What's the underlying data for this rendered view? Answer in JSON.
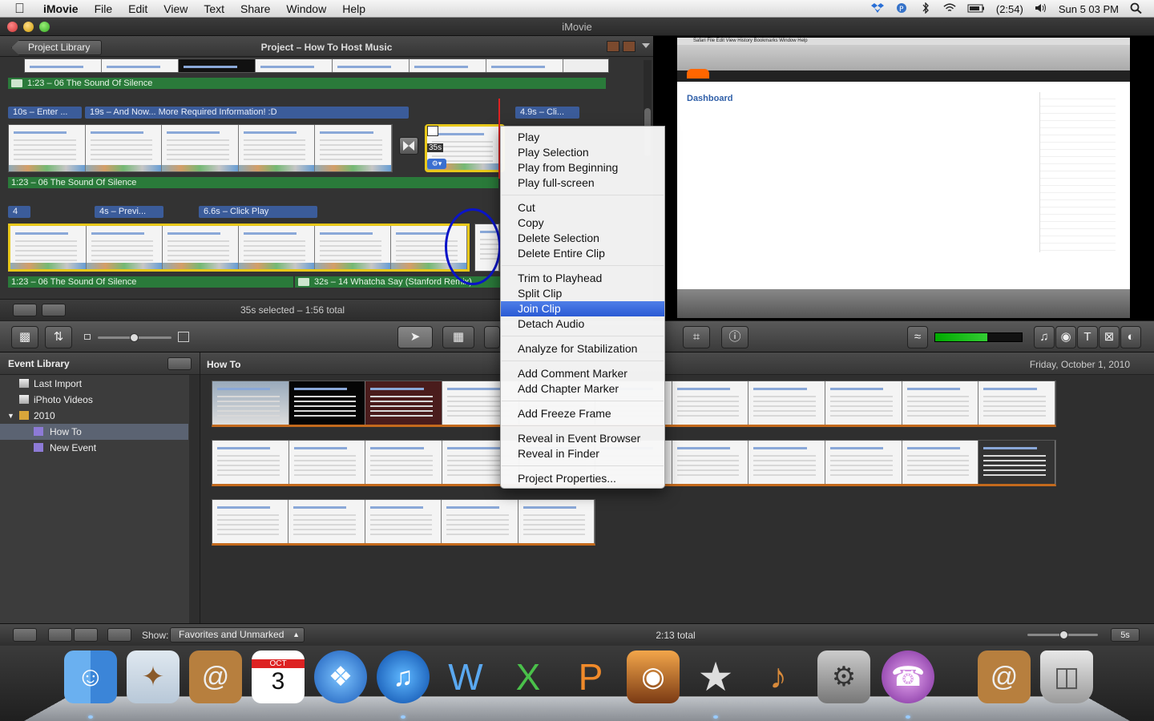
{
  "menubar": {
    "app": "iMovie",
    "menus": [
      "File",
      "Edit",
      "View",
      "Text",
      "Share",
      "Window",
      "Help"
    ],
    "battery": "(2:54)",
    "clock": "Sun 5 03 PM"
  },
  "window": {
    "title": "iMovie"
  },
  "project": {
    "library_button": "Project Library",
    "title": "Project – How To Host Music",
    "rows": [
      {
        "music": "1:23 – 06 The Sound Of Silence"
      },
      {
        "clips": [
          "10s – Enter ...",
          "19s – And Now... More Required Information! :D",
          "4.9s – Cli..."
        ],
        "music": "1:23 – 06 The Sound Of Silence",
        "badge": "35s"
      },
      {
        "clips": [
          "4",
          "4s – Previ...",
          "6.6s – Click Play"
        ],
        "music": "1:23 – 06 The Sound Of Silence",
        "music2": "32s – 14 Whatcha Say (Stanford Remix)"
      }
    ],
    "status": "35s selected – 1:56 total"
  },
  "viewer": {
    "browser_menus": "Safari  File  Edit  View  History  Bookmarks  Window  Help",
    "page_heading": "Dashboard"
  },
  "event_library": {
    "heading": "Event Library",
    "items": [
      {
        "label": "Last Import"
      },
      {
        "label": "iPhoto Videos"
      },
      {
        "label": "2010"
      },
      {
        "label": "How To"
      },
      {
        "label": "New Event"
      }
    ]
  },
  "event_browser": {
    "event_name": "How To",
    "date": "Friday, October 1, 2010"
  },
  "bottombar": {
    "show_label": "Show:",
    "show_value": "Favorites and Unmarked",
    "total": "2:13 total",
    "zoom": "5s"
  },
  "context_menu": {
    "items": [
      "Play",
      "Play Selection",
      "Play from Beginning",
      "Play full-screen",
      "Cut",
      "Copy",
      "Delete Selection",
      "Delete Entire Clip",
      "Trim to Playhead",
      "Split Clip",
      "Join Clip",
      "Detach Audio",
      "Analyze for Stabilization",
      "Add Comment Marker",
      "Add Chapter Marker",
      "Add Freeze Frame",
      "Reveal in Event Browser",
      "Reveal in Finder",
      "Project Properties..."
    ],
    "highlighted": "Join Clip"
  },
  "dock": {
    "icons": [
      "finder-icon",
      "mail-icon",
      "address-book-icon",
      "ical-icon",
      "safari-icon",
      "itunes-icon",
      "word-icon",
      "excel-icon",
      "powerpoint-icon",
      "iphoto-icon",
      "imovie-icon",
      "garageband-icon",
      "system-preferences-icon",
      "broadcast-icon",
      "address-book-icon",
      "trash-icon"
    ],
    "ical_month": "OCT",
    "ical_day": "3"
  }
}
